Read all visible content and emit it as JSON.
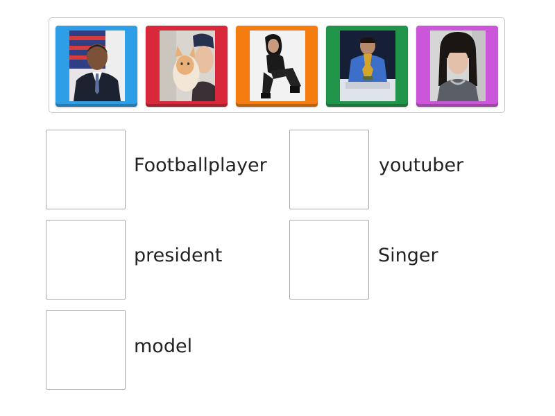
{
  "palette": {
    "tile_colors": [
      "#2e9ee6",
      "#d8283a",
      "#f57d10",
      "#20954a",
      "#cc56d9"
    ]
  },
  "tiles": [
    {
      "icon": "portrait-photo-man-suit-flag"
    },
    {
      "icon": "portrait-photo-man-with-cat"
    },
    {
      "icon": "portrait-photo-woman-sitting"
    },
    {
      "icon": "portrait-photo-man-with-trophy"
    },
    {
      "icon": "portrait-photo-woman-bangs"
    }
  ],
  "targets": [
    {
      "label": "Footballplayer"
    },
    {
      "label": "youtuber"
    },
    {
      "label": "president"
    },
    {
      "label": "Singer"
    },
    {
      "label": "model"
    }
  ]
}
